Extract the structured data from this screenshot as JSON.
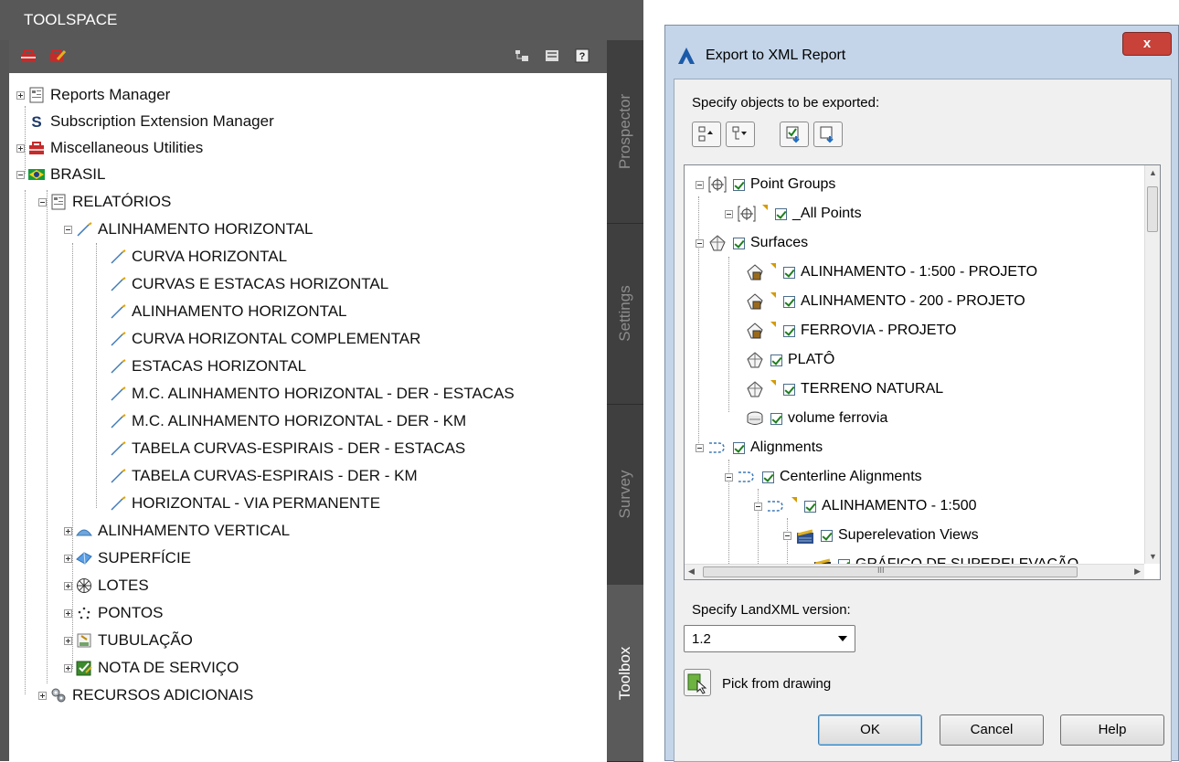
{
  "toolspace": {
    "title": "TOOLSPACE",
    "tabs": [
      "Prospector",
      "Settings",
      "Survey",
      "Toolbox"
    ],
    "active_tab": "Toolbox",
    "tree": [
      {
        "label": "Reports Manager",
        "icon": "report-icon"
      },
      {
        "label": "Subscription Extension Manager",
        "icon": "subscription-s-icon"
      },
      {
        "label": "Miscellaneous Utilities",
        "icon": "toolbox-icon"
      },
      {
        "label": "BRASIL",
        "icon": "brazil-flag-icon"
      },
      {
        "label": "RELATÓRIOS",
        "icon": "report-icon"
      },
      {
        "label": "ALINHAMENTO HORIZONTAL",
        "icon": "alignment-icon"
      },
      {
        "label": "CURVA HORIZONTAL",
        "icon": "alignment-icon"
      },
      {
        "label": "CURVAS E ESTACAS HORIZONTAL",
        "icon": "alignment-icon"
      },
      {
        "label": "ALINHAMENTO HORIZONTAL",
        "icon": "alignment-icon"
      },
      {
        "label": "CURVA HORIZONTAL COMPLEMENTAR",
        "icon": "alignment-icon"
      },
      {
        "label": "ESTACAS HORIZONTAL",
        "icon": "alignment-icon"
      },
      {
        "label": "M.C. ALINHAMENTO HORIZONTAL - DER - ESTACAS",
        "icon": "alignment-icon"
      },
      {
        "label": "M.C. ALINHAMENTO HORIZONTAL - DER - KM",
        "icon": "alignment-icon"
      },
      {
        "label": "TABELA CURVAS-ESPIRAIS - DER - ESTACAS",
        "icon": "alignment-icon"
      },
      {
        "label": "TABELA CURVAS-ESPIRAIS - DER - KM",
        "icon": "alignment-icon"
      },
      {
        "label": "HORIZONTAL - VIA PERMANENTE",
        "icon": "alignment-icon"
      },
      {
        "label": "ALINHAMENTO VERTICAL",
        "icon": "profile-icon"
      },
      {
        "label": "SUPERFÍCIE",
        "icon": "surface-icon"
      },
      {
        "label": "LOTES",
        "icon": "parcel-icon"
      },
      {
        "label": "PONTOS",
        "icon": "points-icon"
      },
      {
        "label": "TUBULAÇÃO",
        "icon": "pipe-icon"
      },
      {
        "label": "NOTA DE SERVIÇO",
        "icon": "checklist-icon"
      },
      {
        "label": "RECURSOS ADICIONAIS",
        "icon": "gears-icon"
      }
    ]
  },
  "dialog": {
    "title": "Export to XML Report",
    "close_label": "x",
    "specify_label": "Specify objects to be exported:",
    "tree": [
      {
        "label": "Point Groups",
        "icon": "point-group-icon"
      },
      {
        "label": "_All Points",
        "icon": "point-group-icon"
      },
      {
        "label": "Surfaces",
        "icon": "surface-icon"
      },
      {
        "label": "ALINHAMENTO - 1:500 - PROJETO",
        "icon": "surface-item-icon"
      },
      {
        "label": "ALINHAMENTO - 200 - PROJETO",
        "icon": "surface-item-icon"
      },
      {
        "label": "FERROVIA - PROJETO",
        "icon": "surface-item-icon"
      },
      {
        "label": "PLATÔ",
        "icon": "surface-icon"
      },
      {
        "label": "TERRENO NATURAL",
        "icon": "surface-icon"
      },
      {
        "label": "volume ferrovia",
        "icon": "volume-surface-icon"
      },
      {
        "label": "Alignments",
        "icon": "alignment-icon"
      },
      {
        "label": "Centerline Alignments",
        "icon": "alignment-icon"
      },
      {
        "label": "ALINHAMENTO - 1:500",
        "icon": "alignment-icon"
      },
      {
        "label": "Superelevation Views",
        "icon": "superelevation-icon"
      },
      {
        "label": "GRÁFICO DE SUPERELEVAÇÃO",
        "icon": "superelevation-icon"
      }
    ],
    "hscroll_glyph": "III",
    "version_label": "Specify LandXML version:",
    "version_value": "1.2",
    "pick_label": "Pick from drawing",
    "ok_label": "OK",
    "cancel_label": "Cancel",
    "help_label": "Help"
  }
}
